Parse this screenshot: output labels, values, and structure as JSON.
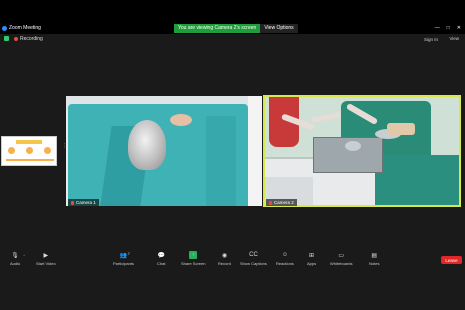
{
  "window": {
    "title": "Zoom Meeting",
    "controls": [
      "—",
      "□",
      "✕"
    ]
  },
  "banner": {
    "message": "You are viewing Camera 2's screen",
    "view_options": "View Options"
  },
  "topbar": {
    "recording": "Recording",
    "sign_in": "Sign In",
    "view": "View"
  },
  "videos": {
    "camera1_label": "Camera 1",
    "camera2_label": "Camera 2"
  },
  "toolbar": {
    "audio": "Audio",
    "start_video": "Start Video",
    "participants": "Participants",
    "participants_count": "7",
    "chat": "Chat",
    "share_screen": "Share Screen",
    "record": "Record",
    "show_captions": "Show Captions",
    "reactions": "Reactions",
    "apps": "Apps",
    "whiteboards": "Whiteboards",
    "notes": "Notes",
    "leave": "Leave"
  },
  "colors": {
    "banner_green": "#1f9d3c",
    "leave_red": "#e02828",
    "active_speaker_border": "#d7e84d"
  },
  "icons": {
    "audio": "microphone-muted-icon",
    "start_video": "video-camera-off-icon",
    "participants": "people-icon",
    "chat": "chat-bubble-icon",
    "share_screen": "share-arrow-icon",
    "record": "record-circle-icon",
    "show_captions": "cc-icon",
    "reactions": "emoji-icon",
    "apps": "apps-icon",
    "whiteboards": "whiteboard-icon",
    "notes": "notes-icon"
  }
}
